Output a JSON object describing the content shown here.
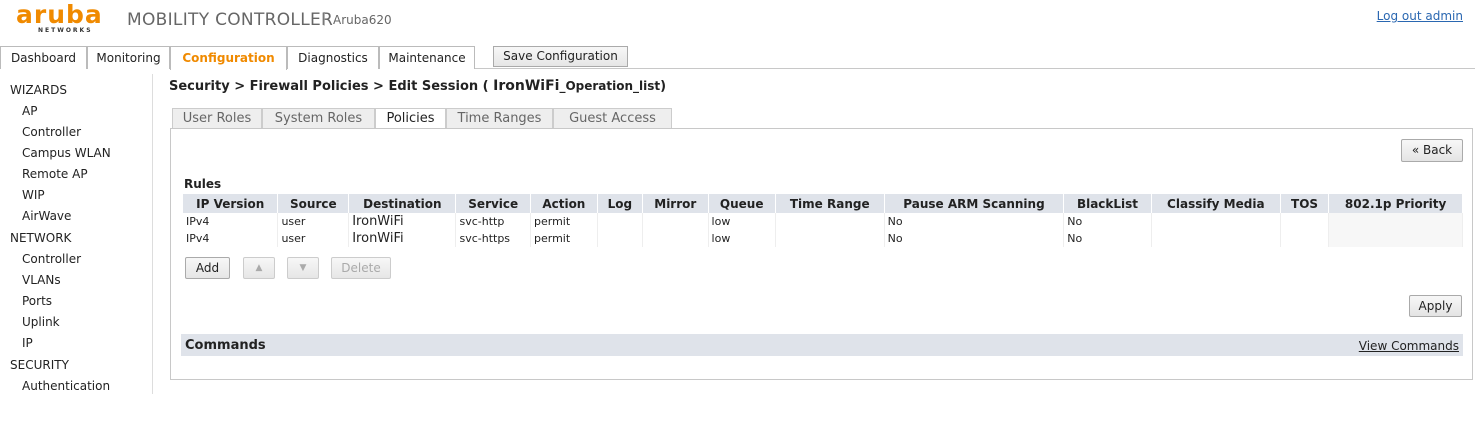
{
  "header": {
    "logo_word": "aruba",
    "logo_sub": "NETWORKS",
    "app_title": "MOBILITY CONTROLLER",
    "divider": "|",
    "hostname": "Aruba620",
    "logout": "Log out admin"
  },
  "topnav": {
    "tabs": [
      "Dashboard",
      "Monitoring",
      "Configuration",
      "Diagnostics",
      "Maintenance"
    ],
    "active": "Configuration",
    "save_label": "Save Configuration"
  },
  "sidebar": {
    "wizards": "WIZARDS",
    "wizard_items": [
      "AP",
      "Controller",
      "Campus WLAN",
      "Remote AP",
      "WIP",
      "AirWave"
    ],
    "network": "NETWORK",
    "network_items": [
      "Controller",
      "VLANs",
      "Ports",
      "Uplink",
      "IP"
    ],
    "security": "SECURITY",
    "security_items": [
      "Authentication"
    ]
  },
  "breadcrumb": {
    "prefix": "Security > Firewall Policies > Edit Session ( ",
    "name_big": "IronWiFi",
    "name_small": "_Operation_list",
    "suffix": ")"
  },
  "subtabs": [
    "User Roles",
    "System Roles",
    "Policies",
    "Time Ranges",
    "Guest Access"
  ],
  "active_subtab": "Policies",
  "panel": {
    "back_label": "« Back",
    "rules_label": "Rules",
    "columns": [
      "IP Version",
      "Source",
      "Destination",
      "Service",
      "Action",
      "Log",
      "Mirror",
      "Queue",
      "Time Range",
      "Pause ARM Scanning",
      "BlackList",
      "Classify Media",
      "TOS",
      "802.1p Priority"
    ],
    "rows": [
      [
        "IPv4",
        "user",
        "IronWiFi",
        "svc-http",
        "permit",
        "",
        "",
        "low",
        "",
        "No",
        "No",
        "",
        "",
        ""
      ],
      [
        "IPv4",
        "user",
        "IronWiFi",
        "svc-https",
        "permit",
        "",
        "",
        "low",
        "",
        "No",
        "No",
        "",
        "",
        ""
      ]
    ],
    "add_label": "Add",
    "up_label": "▲",
    "down_label": "▼",
    "delete_label": "Delete",
    "apply_label": "Apply",
    "commands_label": "Commands",
    "view_commands_label": "View Commands"
  },
  "colors": {
    "brand_orange": "#f08a00",
    "header_blue_gray": "#dfe3ea",
    "link_blue": "#2a67b1"
  }
}
